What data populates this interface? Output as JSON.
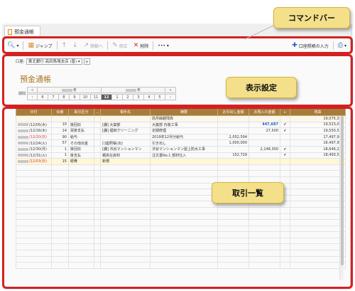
{
  "window": {
    "tab_title": "預金通帳"
  },
  "toolbar": {
    "jump": "ジャンプ",
    "move_to": "移動へ",
    "edit": "修正",
    "delete": "削除",
    "more": "•••",
    "passbook_input": "口座照帳の入力"
  },
  "account": {
    "label": "口座:",
    "selected": "東北銀行 高田馬場支店 (普)"
  },
  "passbook": {
    "title": "預金通帳",
    "period_label": "期間:",
    "year_left": "年",
    "year_right": "年",
    "months": [
      "6",
      "7",
      "8",
      "9",
      "10",
      "11",
      "12",
      "1",
      "2",
      "3",
      "4",
      "5"
    ],
    "active_month": "12"
  },
  "table": {
    "headers": [
      "日付",
      "伝番",
      "取引区分",
      "…",
      "相手先",
      "摘要",
      "お引出し金額",
      "お預入れ金額",
      "レ",
      "残高"
    ],
    "rows": [
      {
        "date": "",
        "no": "",
        "type": "",
        "flag": "",
        "partner": "",
        "memo": "前月繰越残高",
        "out": "",
        "in": "",
        "check": "",
        "balance": "19,075,375",
        "date_red": false
      },
      {
        "date": "/12/05(木)",
        "no": "10",
        "type": "掛回収",
        "flag": "",
        "partner": "[課] 大築部",
        "memo": "大築部 内装工事",
        "out": "",
        "in": "447,687",
        "check": "✔",
        "balance": "19,523,062",
        "date_red": false
      },
      {
        "date": "/12/16(木)",
        "no": "14",
        "type": "買掛支払",
        "flag": "",
        "partner": "[課] 福田クリーニング",
        "memo": "定期修理",
        "out": "",
        "in": "27,500",
        "check": "✔",
        "balance": "19,550,562",
        "date_red": false
      },
      {
        "date": "/12/20(日)",
        "no": "90",
        "type": "給与",
        "flag": "",
        "partner": "",
        "memo": "2019年12月分給与",
        "out": "2,052,594",
        "in": "",
        "check": "",
        "balance": "17,497,968",
        "date_red": true
      },
      {
        "date": "/12/24(火)",
        "no": "57",
        "type": "その他出金",
        "flag": "",
        "partner": "口座照帳(出)",
        "memo": "引き出し",
        "out": "1,000,000",
        "in": "",
        "check": "",
        "balance": "16,497,968",
        "date_red": false
      },
      {
        "date": "/12/30(月)",
        "no": "1",
        "type": "掛回収",
        "flag": "",
        "partner": "[課] 渋谷マンションマン",
        "memo": "渋谷マンションマン屋上防水工事",
        "out": "",
        "in": "2,148,300",
        "check": "✔",
        "balance": "18,646,268",
        "date_red": false
      },
      {
        "date": "/12/31(火)",
        "no": "1",
        "type": "掛支払",
        "flag": "",
        "partner": "積高在資材",
        "memo": "注文書No.1 部材仕入",
        "out": "152,729",
        "in": "",
        "check": "✔",
        "balance": "18,493,540",
        "date_red": false
      },
      {
        "date": "/12/03(日)",
        "no": "15",
        "type": "経費",
        "flag": "",
        "partner": "新規",
        "memo": "",
        "out": "",
        "in": "",
        "check": "",
        "balance": "",
        "date_red": true
      }
    ]
  },
  "callouts": {
    "command_bar": "コマンドバー",
    "display_settings": "表示設定",
    "transactions": "取引一覧"
  },
  "colors": {
    "header_bg": "#a67c3b",
    "highlight": "#d42020",
    "callout_bg": "#f4e08a",
    "title_color": "#a9761e"
  }
}
